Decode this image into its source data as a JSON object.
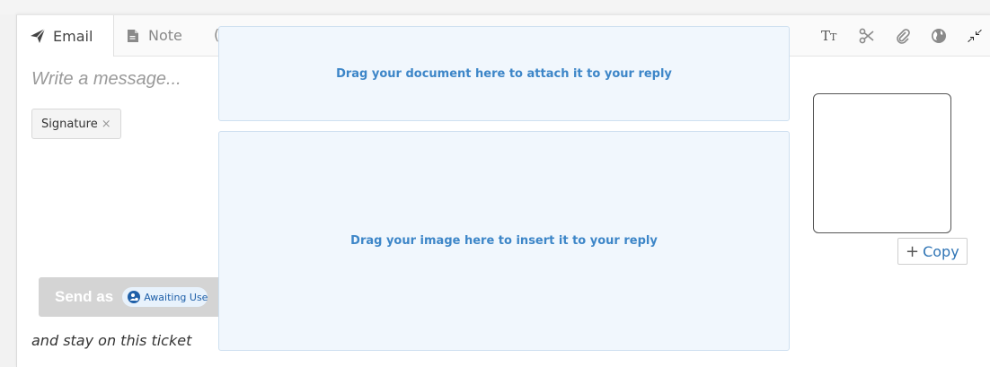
{
  "tabs": [
    {
      "label": "Email",
      "icon": "paper-plane-icon",
      "active": true
    },
    {
      "label": "Note",
      "icon": "note-icon",
      "active": false
    }
  ],
  "toolbar": {
    "tools": [
      {
        "name": "text-format-icon",
        "glyph": "Tт"
      },
      {
        "name": "scissors-icon",
        "glyph": "✂"
      },
      {
        "name": "paperclip-icon",
        "glyph": "📎"
      },
      {
        "name": "globe-icon",
        "glyph": "◕"
      },
      {
        "name": "collapse-icon",
        "glyph": "⤡"
      }
    ]
  },
  "editor": {
    "placeholder": "Write a message...",
    "signature_chip": "Signature",
    "signature_remove": "×"
  },
  "send": {
    "label": "Send as",
    "status": "Awaiting Use",
    "stay_text": "and stay on this ticket"
  },
  "dropzones": {
    "document": "Drag your document here to attach it to your reply",
    "image": "Drag your image here to insert it to your reply"
  },
  "copy_button": {
    "label": "Copy",
    "plus": "+"
  },
  "colors": {
    "accent": "#3d86c8",
    "dropzone_bg": "#f1f7fd",
    "send_bar": "#d4d4d4",
    "status_pill_text": "#1e5fa8"
  }
}
